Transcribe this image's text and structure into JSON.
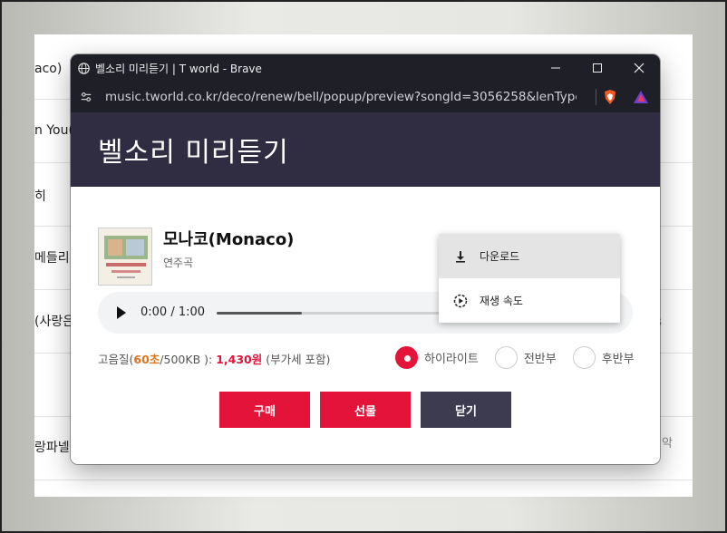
{
  "background_page": {
    "rows": [
      "aco)",
      "n You(",
      "히",
      "메들리",
      "(사랑은",
      "",
      "랑파넬리"
    ],
    "right_items": [
      "",
      "",
      "",
      "",
      "s",
      "",
      "악"
    ]
  },
  "window": {
    "title": "벨소리 미리듣기 | T world - Brave",
    "url": "music.tworld.co.kr/deco/renew/bell/popup/preview?songId=3056258&lenType=L..."
  },
  "popup": {
    "header_title": "벨소리 미리듣기",
    "song": {
      "title": "모나코(Monaco)",
      "subtitle": "연주곡"
    },
    "player": {
      "time": "0:00 / 1:00",
      "progress": 0.36
    },
    "price": {
      "prefix": "고음질(",
      "seconds": "60초",
      "size": "/500KB ): ",
      "amount": "1,430원",
      "tax": " (부가세 포함)"
    },
    "options": [
      {
        "label": "하이라이트",
        "selected": true
      },
      {
        "label": "전반부",
        "selected": false
      },
      {
        "label": "후반부",
        "selected": false
      }
    ],
    "buttons": {
      "buy": "구매",
      "gift": "선물",
      "close": "닫기"
    },
    "context_menu": [
      {
        "label": "다운로드",
        "icon": "download-icon",
        "highlighted": true
      },
      {
        "label": "재생 속도",
        "icon": "playback-speed-icon",
        "highlighted": false
      }
    ]
  },
  "colors": {
    "accent_red": "#e3133a",
    "header_bg": "#302d42",
    "close_btn": "#3d3b4f",
    "orange": "#e0751f"
  }
}
